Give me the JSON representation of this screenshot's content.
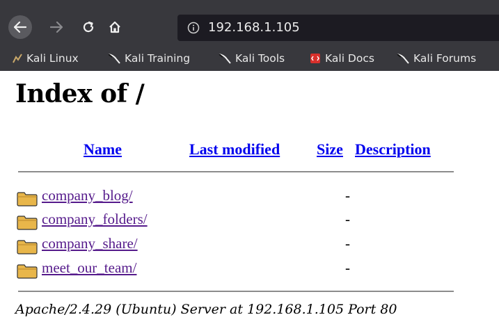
{
  "browser": {
    "url": "192.168.1.105",
    "bookmarks": [
      "Kali Linux",
      "Kali Training",
      "Kali Tools",
      "Kali Docs",
      "Kali Forums"
    ]
  },
  "page": {
    "title": "Index of /",
    "columns": {
      "name": "Name",
      "last_modified": "Last modified",
      "size": "Size",
      "description": "Description"
    },
    "rows": [
      {
        "name": "company_blog/",
        "size": "-"
      },
      {
        "name": "company_folders/",
        "size": "-"
      },
      {
        "name": "company_share/",
        "size": "-"
      },
      {
        "name": "meet_our_team/",
        "size": "-"
      }
    ],
    "address": "Apache/2.4.29 (Ubuntu) Server at 192.168.1.105 Port 80"
  },
  "icons": [
    "back-icon",
    "forward-icon",
    "reload-icon",
    "home-icon",
    "info-icon",
    "kali-icon",
    "docs-icon",
    "folder-icon"
  ],
  "colors": {
    "link": "#0000ee",
    "visited_link": "#551a8b",
    "toolbar": "#38383d"
  }
}
